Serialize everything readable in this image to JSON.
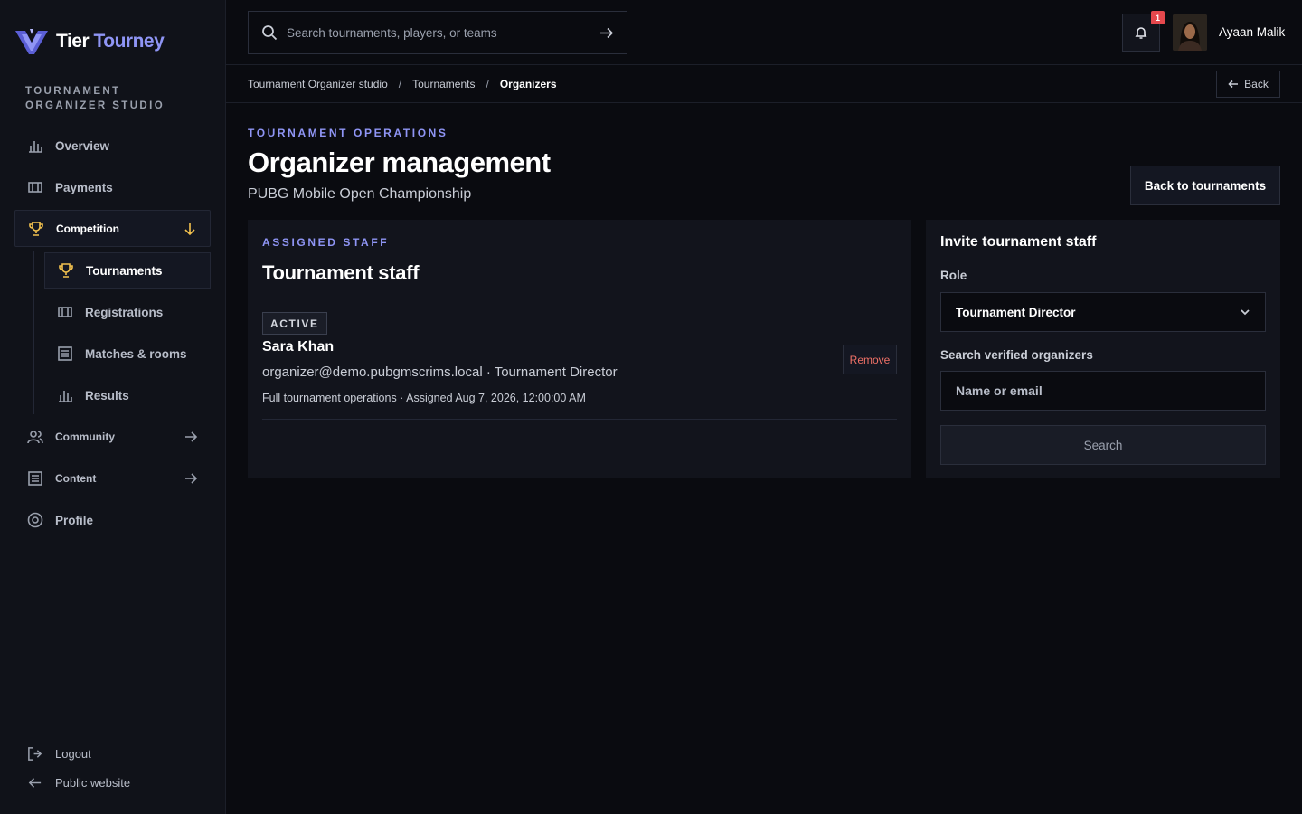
{
  "brand": {
    "name_part1": "Tier",
    "name_part2": "Tourney"
  },
  "sidebar": {
    "section_label": "TOURNAMENT ORGANIZER STUDIO",
    "items": [
      {
        "label": "Overview",
        "icon": "bar-chart-icon"
      },
      {
        "label": "Payments",
        "icon": "ticket-icon"
      },
      {
        "label": "Competition",
        "icon": "trophy-icon",
        "expanded": true
      },
      {
        "label": "Community",
        "icon": "users-icon"
      },
      {
        "label": "Content",
        "icon": "document-icon"
      },
      {
        "label": "Profile",
        "icon": "settings-circle-icon"
      }
    ],
    "competition_children": [
      {
        "label": "Tournaments",
        "icon": "trophy-icon",
        "active": true
      },
      {
        "label": "Registrations",
        "icon": "ticket-icon"
      },
      {
        "label": "Matches & rooms",
        "icon": "list-icon"
      },
      {
        "label": "Results",
        "icon": "bar-chart-icon"
      }
    ],
    "footer": {
      "logout": "Logout",
      "public_website": "Public website"
    }
  },
  "topbar": {
    "search_placeholder": "Search tournaments, players, or teams",
    "notification_count": "1",
    "user_name": "Ayaan Malik"
  },
  "breadcrumb": {
    "items": [
      "Tournament Organizer studio",
      "Tournaments",
      "Organizers"
    ],
    "separator": "/",
    "back_label": "Back"
  },
  "header": {
    "eyebrow": "TOURNAMENT OPERATIONS",
    "title": "Organizer management",
    "subtitle": "PUBG Mobile Open Championship",
    "back_to_tournaments": "Back to tournaments"
  },
  "staff": {
    "eyebrow": "ASSIGNED STAFF",
    "title": "Tournament staff",
    "members": [
      {
        "status": "ACTIVE",
        "name": "Sara Khan",
        "email_role": "organizer@demo.pubgmscrims.local · Tournament Director",
        "meta": "Full tournament operations · Assigned Aug 7, 2026, 12:00:00 AM",
        "remove_label": "Remove"
      }
    ]
  },
  "invite": {
    "title": "Invite tournament staff",
    "role_label": "Role",
    "role_value": "Tournament Director",
    "search_label": "Search verified organizers",
    "search_placeholder": "Name or email",
    "search_button": "Search"
  },
  "colors": {
    "accent": "#8f95f5",
    "active_icon": "#f2c14e",
    "danger": "#f07167",
    "badge": "#e5484d",
    "bg": "#0a0b10",
    "panel": "#12141c"
  }
}
